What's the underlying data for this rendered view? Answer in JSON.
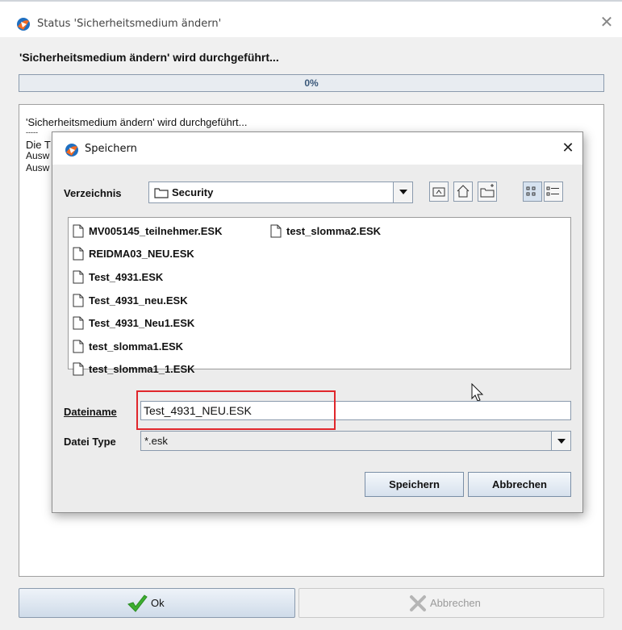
{
  "outer": {
    "title": "Status 'Sicherheitsmedium ändern'",
    "heading": "'Sicherheitsmedium ändern' wird durchgeführt...",
    "progress": {
      "value": 0,
      "label": "0%"
    },
    "log_lines": [
      "'Sicherheitsmedium ändern' wird durchgeführt...",
      "-----",
      "Die T",
      "Ausw",
      "Ausw"
    ],
    "ok_label": "Ok",
    "cancel_label": "Abbrechen"
  },
  "save_dialog": {
    "title": "Speichern",
    "directory_label": "Verzeichnis",
    "directory_value": "Security",
    "files": [
      "MV005145_teilnehmer.ESK",
      "test_slomma2.ESK",
      "REIDMA03_NEU.ESK",
      "Test_4931.ESK",
      "Test_4931_neu.ESK",
      "Test_4931_Neu1.ESK",
      "test_slomma1.ESK",
      "test_slomma1_1.ESK"
    ],
    "filename_label": "Dateiname",
    "filename_value": "Test_4931_NEU.ESK",
    "filetype_label": "Datei Type",
    "filetype_value": "*.esk",
    "save_label": "Speichern",
    "cancel_label": "Abbrechen"
  },
  "icons": {
    "app_logo": "app-logo-icon",
    "close": "close-icon",
    "folder": "folder-icon",
    "file": "file-icon",
    "ok": "checkmark-icon",
    "cancel": "x-icon"
  },
  "colors": {
    "highlight": "#e0262b",
    "progress_text": "#3a587a",
    "ok_check": "#3cae2f"
  }
}
